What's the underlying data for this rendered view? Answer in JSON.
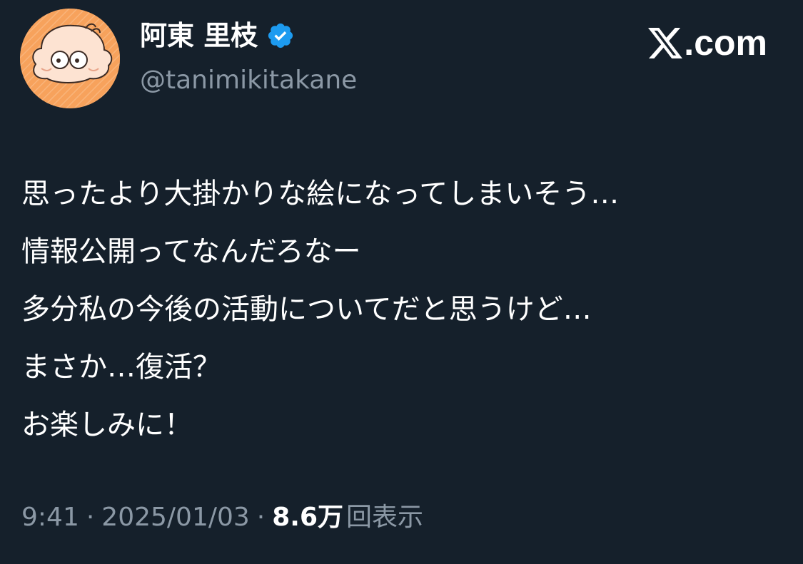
{
  "author": {
    "display_name": "阿東 里枝",
    "handle": "@tanimikitakane",
    "verified": true
  },
  "brand": {
    "label": ".com",
    "logo": "x-logo-icon"
  },
  "tweet": {
    "lines": [
      "思ったより大掛かりな絵になってしまいそう…",
      "情報公開ってなんだろなー",
      "多分私の今後の活動についてだと思うけど…",
      "まさか…復活？",
      "お楽しみに！"
    ]
  },
  "meta": {
    "time": "9:41",
    "separator": "·",
    "date": "2025/01/03",
    "views_count": "8.6万",
    "views_label": "回表示"
  },
  "colors": {
    "background": "#15202b",
    "primary_text": "#ffffff",
    "secondary_text": "#8b98a5",
    "verified_badge": "#1d9bf0",
    "avatar_bg": "#f7a25c"
  }
}
